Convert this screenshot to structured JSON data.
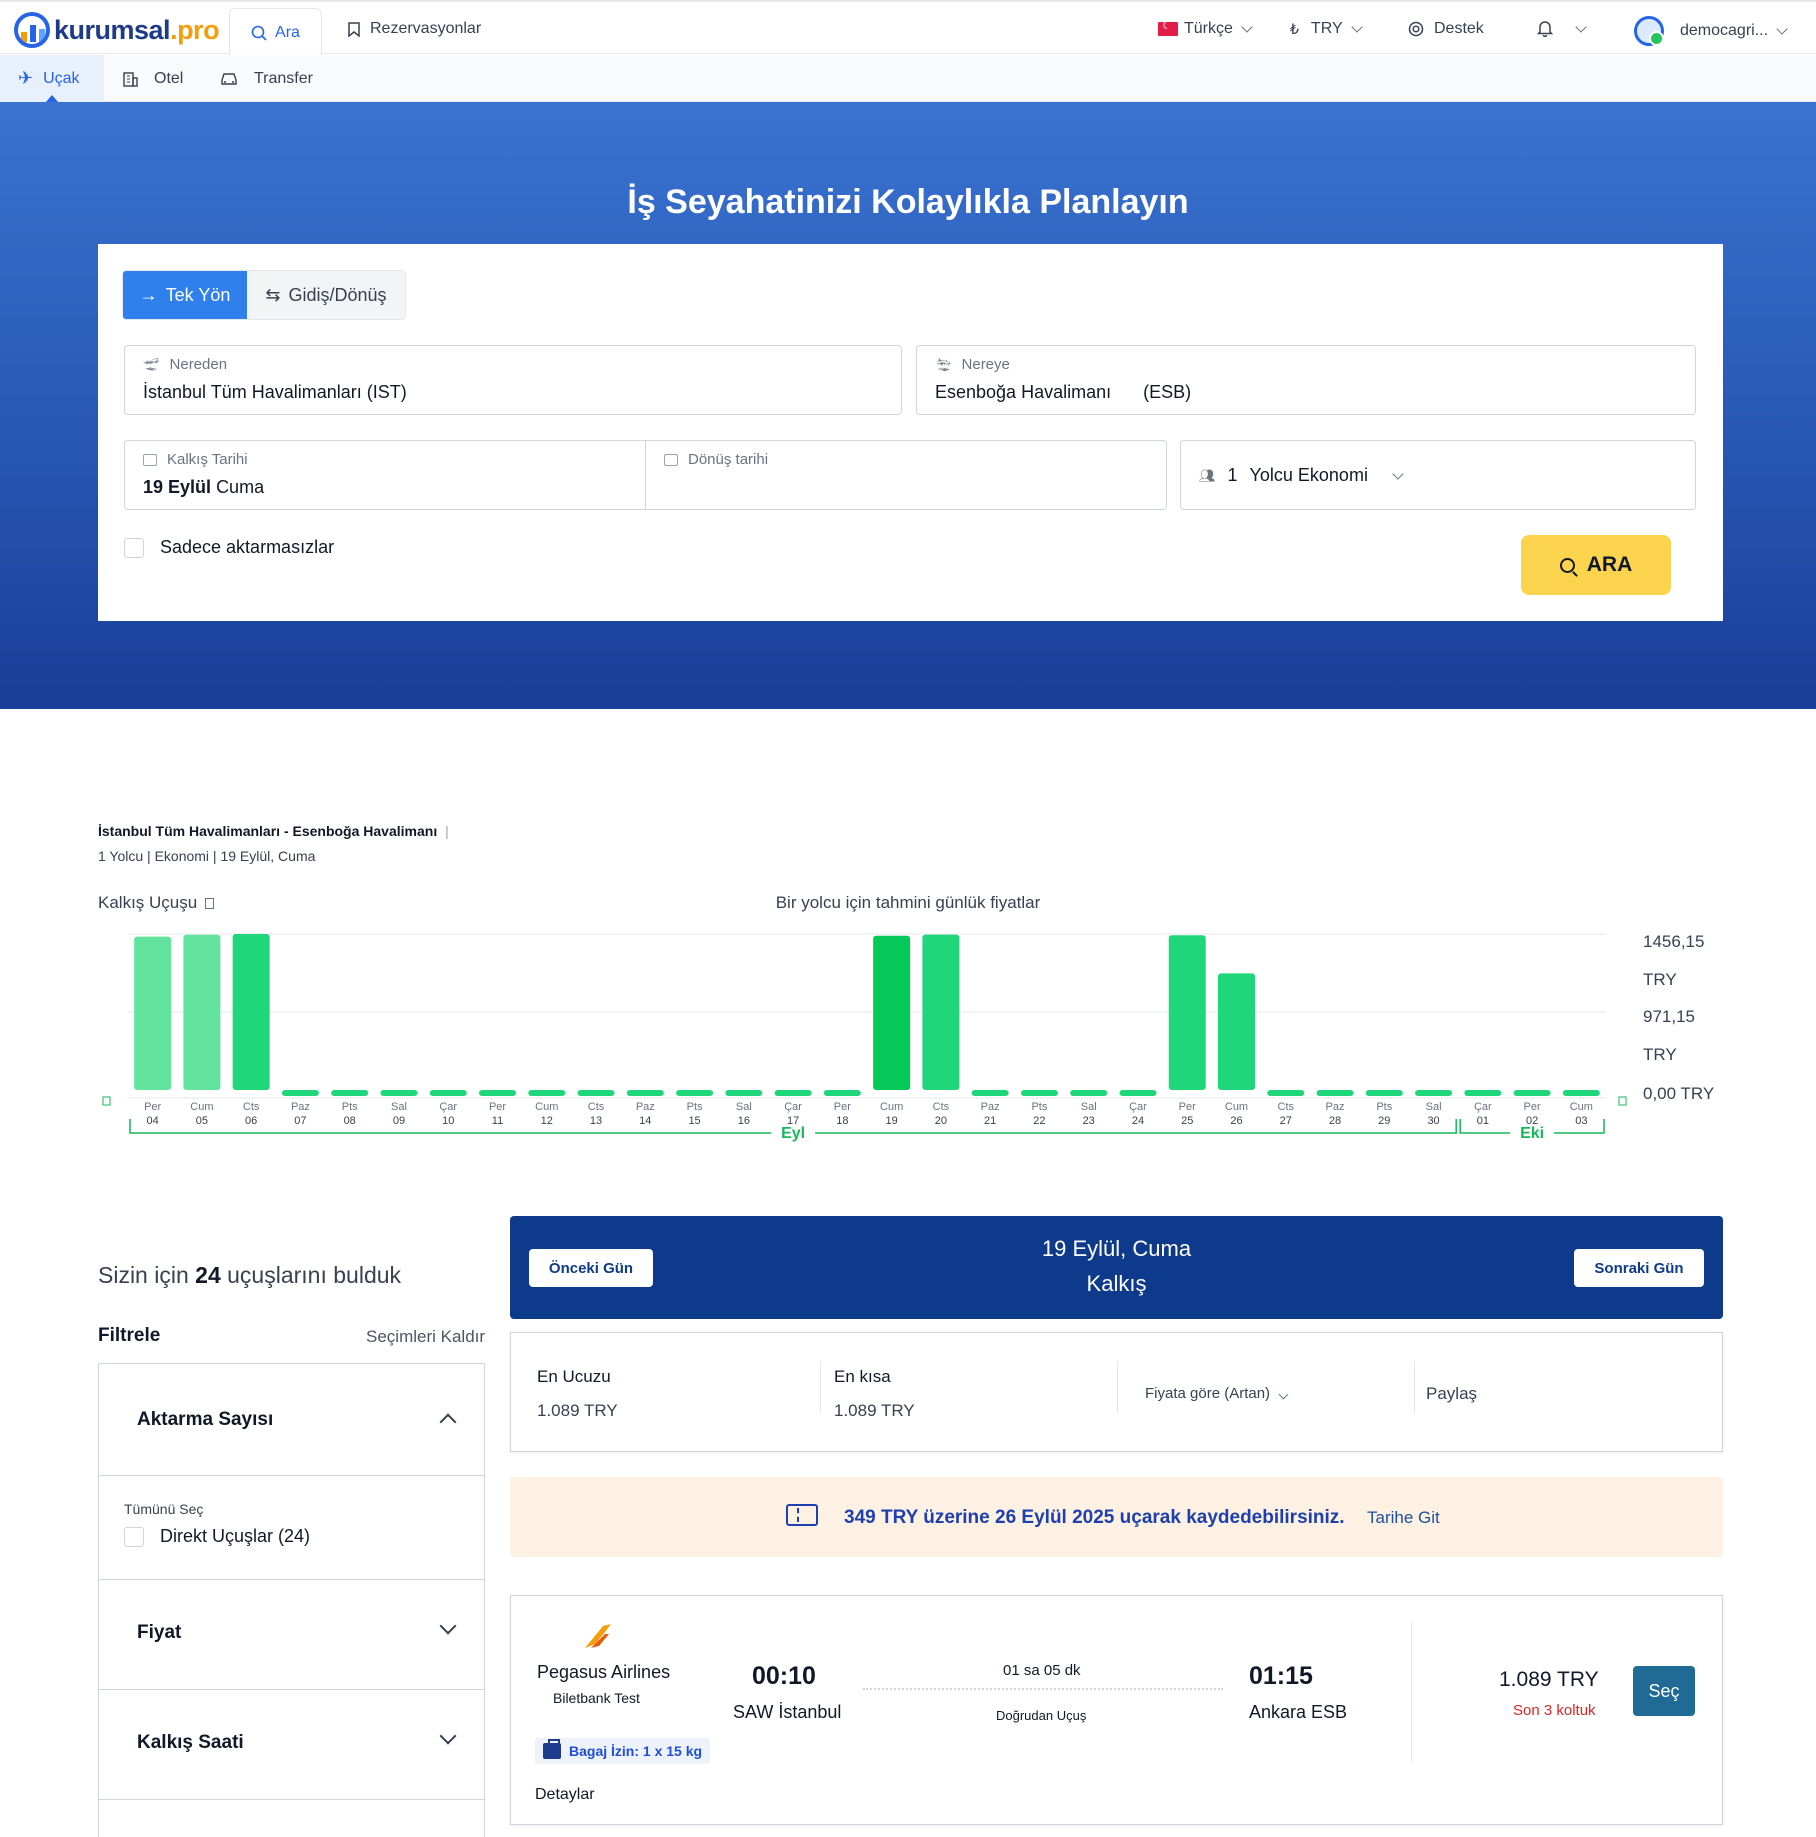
{
  "nav": {
    "brand_main": "kurumsal",
    "brand_tld": ".pro",
    "search_tab": "Ara",
    "reservations_tab": "Rezervasyonlar",
    "language": "Türkçe",
    "currency": "TRY",
    "support": "Destek",
    "username": "democagri..."
  },
  "subnav": {
    "items": [
      "Uçak",
      "Otel",
      "Transfer"
    ]
  },
  "hero": {
    "title": "İş Seyahatinizi Kolaylıkla Planlayın",
    "one_way": "Tek Yön",
    "round_trip": "Gidiş/Dönüş",
    "from_label": "Nereden",
    "from_value": "İstanbul Tüm Havalimanları (IST)",
    "to_label": "Nereye",
    "to_value": "Esenboğa Havalimanı",
    "to_code": "(ESB)",
    "depart_label": "Kalkış Tarihi",
    "depart_value_bold": "19 Eylül",
    "depart_value_day": "Cuma",
    "return_label": "Dönüş tarihi",
    "passenger_count": "1",
    "passenger_text": "Yolcu Ekonomi",
    "direct_only": "Sadece aktarmasızlar",
    "search_button": "ARA"
  },
  "summary": {
    "route": "İstanbul Tüm Havalimanları - Esenboğa Havalimanı",
    "sep": "|",
    "details": "1 Yolcu | Ekonomi | 19 Eylül, Cuma",
    "chart_left_title": "Kalkış Uçuşu",
    "chart_center_title": "Bir yolcu için tahmini günlük fiyatlar"
  },
  "chart_data": {
    "type": "bar",
    "title": "Bir yolcu için tahmini günlük fiyatlar",
    "day_names": [
      "Per",
      "Cum",
      "Cts",
      "Paz",
      "Pts",
      "Sal",
      "Çar",
      "Per",
      "Cum",
      "Cts",
      "Paz",
      "Pts",
      "Sal",
      "Çar",
      "Per",
      "Cum",
      "Cts",
      "Paz",
      "Pts",
      "Sal",
      "Çar",
      "Per",
      "Cum",
      "Cts",
      "Paz",
      "Pts",
      "Sal",
      "Çar",
      "Per",
      "Cum"
    ],
    "day_numbers": [
      "04",
      "05",
      "06",
      "07",
      "08",
      "09",
      "10",
      "11",
      "12",
      "13",
      "14",
      "15",
      "16",
      "17",
      "18",
      "19",
      "20",
      "21",
      "22",
      "23",
      "24",
      "25",
      "26",
      "27",
      "28",
      "29",
      "30",
      "01",
      "02",
      "03"
    ],
    "values": [
      1432,
      1449,
      1456,
      0,
      0,
      0,
      0,
      0,
      0,
      0,
      0,
      0,
      0,
      0,
      0,
      1440,
      1450,
      0,
      0,
      0,
      0,
      1445,
      1089,
      0,
      0,
      0,
      0,
      0,
      0,
      0
    ],
    "past_days": [
      true,
      true,
      false,
      false,
      false,
      false,
      false,
      false,
      false,
      false,
      false,
      false,
      false,
      false,
      false,
      false,
      false,
      false,
      false,
      false,
      false,
      false,
      false,
      false,
      false,
      false,
      false,
      false,
      false,
      false
    ],
    "selected_index": 15,
    "y_tick_labels": [
      "1456,15",
      "TRY",
      "971,15",
      "TRY",
      "0,00 TRY"
    ],
    "ylim": [
      0,
      1456.15
    ],
    "month_groups": [
      {
        "label": "Eyl",
        "start": 0,
        "end": 26
      },
      {
        "label": "Eki",
        "start": 27,
        "end": 29
      }
    ],
    "colors": {
      "bar": "#1fd67a",
      "past": "#63e49e",
      "selected": "#04c857",
      "month": "#16b85a"
    }
  },
  "results": {
    "found_prefix": "Sizin için",
    "found_count": "24",
    "found_suffix": "uçuşlarını bulduk",
    "filter_title": "Filtrele",
    "filter_clear": "Seçimleri Kaldır",
    "sections": {
      "transfers": "Aktarma Sayısı",
      "select_all": "Tümünü Seç",
      "direct": "Direkt Uçuşlar (24)",
      "price": "Fiyat",
      "departure_time": "Kalkış Saati"
    },
    "prev_day": "Önceki Gün",
    "next_day": "Sonraki Gün",
    "current_date": "19 Eylül, Cuma",
    "direction": "Kalkış",
    "cheapest_label": "En Ucuzu",
    "cheapest_value": "1.089 TRY",
    "shortest_label": "En kısa",
    "shortest_value": "1.089 TRY",
    "sort_label": "Fiyata göre (Artan)",
    "share": "Paylaş",
    "promo_text": "349 TRY üzerine 26 Eylül 2025 uçarak kaydedebilirsiniz.",
    "promo_link": "Tarihe Git"
  },
  "flight": {
    "airline": "Pegasus Airlines",
    "provider": "Biletbank Test",
    "depart_time": "00:10",
    "depart_place": "SAW İstanbul",
    "duration": "01 sa 05 dk",
    "type": "Doğrudan Uçuş",
    "arrive_time": "01:15",
    "arrive_place": "Ankara ESB",
    "baggage": "Bagaj İzin: 1 x 15 kg",
    "details": "Detaylar",
    "price": "1.089 TRY",
    "seats_left": "Son 3 koltuk",
    "select": "Seç"
  }
}
